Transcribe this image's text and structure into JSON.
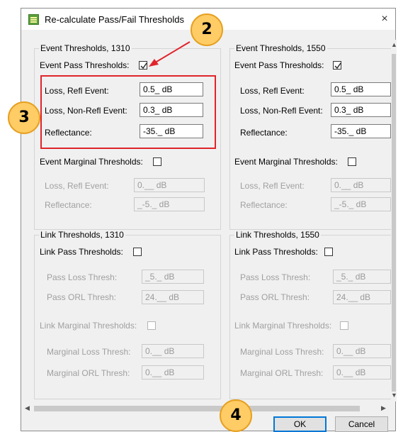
{
  "dialog": {
    "title": "Re-calculate Pass/Fail Thresholds",
    "close_glyph": "×",
    "ok_label": "OK",
    "cancel_label": "Cancel"
  },
  "col1310": {
    "event_group": "Event Thresholds, 1310",
    "event_pass_label": "Event Pass Thresholds:",
    "event_pass_checked": true,
    "loss_refl_label": "Loss, Refl Event:",
    "loss_refl_value": "0.5_ dB",
    "loss_nonrefl_label": "Loss, Non-Refl Event:",
    "loss_nonrefl_value": "0.3_ dB",
    "reflectance_label": "Reflectance:",
    "reflectance_value": "-35._ dB",
    "event_marginal_label": "Event Marginal Thresholds:",
    "m_loss_refl_label": "Loss, Refl Event:",
    "m_loss_refl_value": "0.__ dB",
    "m_reflectance_label": "Reflectance:",
    "m_reflectance_value": "_-5._ dB",
    "link_group": "Link Thresholds, 1310",
    "link_pass_label": "Link Pass Thresholds:",
    "pass_loss_label": "Pass Loss Thresh:",
    "pass_loss_value": "_5._ dB",
    "pass_orl_label": "Pass ORL Thresh:",
    "pass_orl_value": "24.__ dB",
    "link_marginal_label": "Link Marginal Thresholds:",
    "marg_loss_label": "Marginal Loss Thresh:",
    "marg_loss_value": "0.__ dB",
    "marg_orl_label": "Marginal ORL Thresh:",
    "marg_orl_value": "0.__ dB"
  },
  "col1550": {
    "event_group": "Event Thresholds, 1550",
    "event_pass_label": "Event Pass Thresholds:",
    "event_pass_checked": true,
    "loss_refl_label": "Loss, Refl Event:",
    "loss_refl_value": "0.5_ dB",
    "loss_nonrefl_label": "Loss, Non-Refl Event:",
    "loss_nonrefl_value": "0.3_ dB",
    "reflectance_label": "Reflectance:",
    "reflectance_value": "-35._ dB",
    "event_marginal_label": "Event Marginal Thresholds:",
    "m_loss_refl_label": "Loss, Refl Event:",
    "m_loss_refl_value": "0.__ dB",
    "m_reflectance_label": "Reflectance:",
    "m_reflectance_value": "_-5._ dB",
    "link_group": "Link Thresholds, 1550",
    "link_pass_label": "Link Pass Thresholds:",
    "pass_loss_label": "Pass Loss Thresh:",
    "pass_loss_value": "_5._ dB",
    "pass_orl_label": "Pass ORL Thresh:",
    "pass_orl_value": "24.__ dB",
    "link_marginal_label": "Link Marginal Thresholds:",
    "marg_loss_label": "Marginal Loss Thresh:",
    "marg_loss_value": "0.__ dB",
    "marg_orl_label": "Marginal ORL Thresh:",
    "marg_orl_value": "0.__ dB"
  },
  "callouts": {
    "c2": "2",
    "c3": "3",
    "c4": "4"
  },
  "colors": {
    "callout_fill": "#ffcc66",
    "highlight": "#e0242b"
  }
}
